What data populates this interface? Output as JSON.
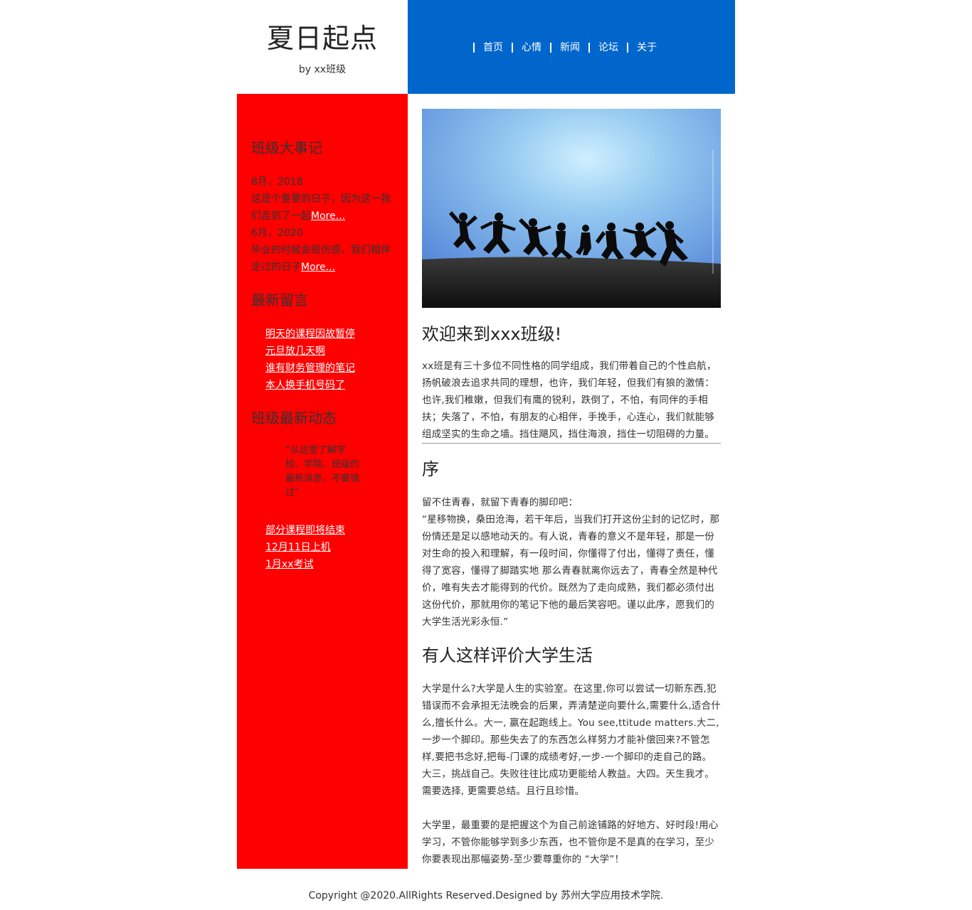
{
  "header": {
    "site_title": "夏日起点",
    "byline": "by xx班级",
    "nav": [
      "首页",
      "心情",
      "新闻",
      "论坛",
      "关于"
    ]
  },
  "sidebar": {
    "events": {
      "heading": "班级大事记",
      "items": [
        {
          "date": "8月，2018",
          "text": "这是个重要的日子，因为这一我们走到了一起",
          "more": "More..."
        },
        {
          "date": "6月，2020",
          "text": "毕业的时候会很伤感，我们相伴走过的日子",
          "more": "More..."
        }
      ]
    },
    "messages": {
      "heading": "最新留言",
      "links": [
        "明天的课程因故暂停",
        "元旦放几天啊",
        "谁有财务管理的笔记",
        "本人换手机号码了"
      ]
    },
    "news": {
      "heading": "班级最新动态",
      "quote": "“从这里了解学校、学院、班级的最新消息，不要错过”",
      "links": [
        "部分课程即将结束",
        "12月11日上机",
        "1月xx考试"
      ]
    }
  },
  "main": {
    "welcome_title": "欢迎来到xxx班级!",
    "welcome_text": "xx班是有三十多位不同性格的同学组成，我们带着自己的个性启航，扬帆破浪去追求共同的理想，也许，我们年轻，但我们有狼的激情：也许,我们稚嫩，但我们有鹰的锐利，跌倒了，不怕，有同伴的手相扶；失落了，不怕，有朋友的心相伴，手挽手，心连心，我们就能够组成坚实的生命之墙。挡住飓风，挡住海浪，挡住一切阻碍的力量。",
    "preface_title": "序",
    "preface_lead": "留不住青春，就留下青春的脚印吧：",
    "preface_text": "“星移物换，桑田沧海，若干年后，当我们打开这份尘封的记忆时，那份情还是足以感地动天的。有人说，青春的意义不是年轻，那是一份对生命的投入和理解，有一段时间，你懂得了付出，懂得了责任，懂得了宽容，懂得了脚踏实地 那么青春就离你远去了，青春全然是种代价，唯有失去才能得到的代价。既然为了走向成熟，我们都必须付出这份代价，那就用你的笔记下他的最后笑容吧。谨以此序，愿我们的大学生活光彩永恒.”",
    "review_title": "有人这样评价大学生活",
    "review_p1": "大学是什么?大学是人生的实验室。在这里,你可以尝试一切新东西,犯错误而不会承担无法晚会的后果，弄清楚逆向要什么,需要什么,适合什么,擅长什么。大一, 赢在起跑线上。You see,ttitude matters.大二,一步一个脚印。那些失去了的东西怎么样努力才能补偿回来?不管怎样,要把书念好,把每-门课的成绩考好,一步-一个脚印的走自己的路。大三，挑战自己。失败往往比成功更能给人教益。大四。天生我才。需要选择, 更需要总结。且行且珍惜。",
    "review_p2": "大学里，最重要的是把握这个为自己前途铺路的好地方、好时段!用心学习，不管你能够学到多少东西，也不管你是不是真的在学习，至少你要表现出那幅姿势-至少要尊重你的 “大学”！"
  },
  "footer": {
    "copyright": "Copyright @2020.AllRights Reserved.Designed by 苏州大学应用技术学院."
  },
  "colors": {
    "nav_bg": "#0066cc",
    "sidebar_bg": "#ff0000",
    "link": "#ffffff"
  }
}
